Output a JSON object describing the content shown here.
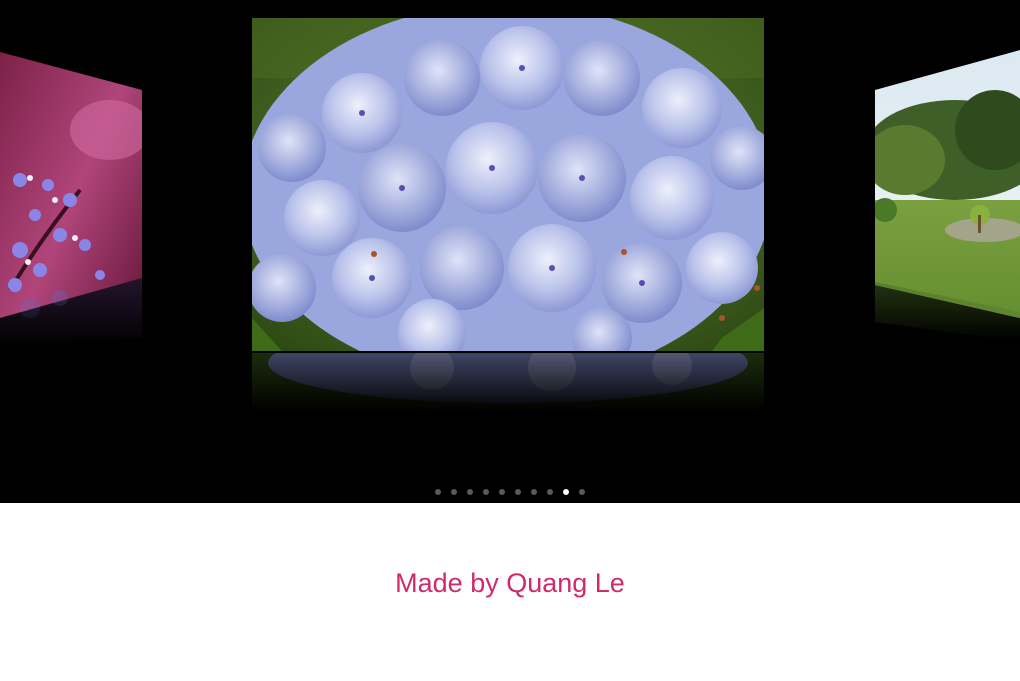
{
  "carousel": {
    "slides": [
      {
        "subject": "purple-flowers-photo"
      },
      {
        "subject": "blue-hydrangea-photo"
      },
      {
        "subject": "garden-landscape-photo"
      }
    ],
    "active_slide": 1,
    "page_count": 10,
    "active_page": 8
  },
  "footer": {
    "credit_text": "Made by Quang Le",
    "credit_color": "#cf2a6a"
  }
}
